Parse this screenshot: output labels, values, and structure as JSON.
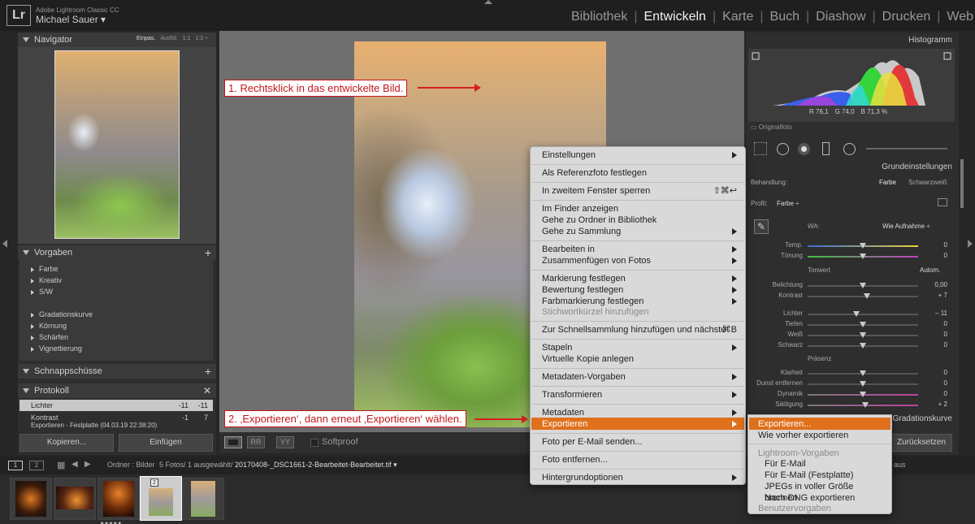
{
  "app": {
    "name": "Adobe Lightroom Classic CC",
    "user": "Michael Sauer ▾",
    "logo": "Lr"
  },
  "modules": [
    "Bibliothek",
    "Entwickeln",
    "Karte",
    "Buch",
    "Diashow",
    "Drucken",
    "Web"
  ],
  "active_module": "Entwickeln",
  "left": {
    "navigator": {
      "title": "Navigator",
      "zoom": [
        "Einpas.",
        "Ausfül.",
        "1:1",
        "1:2 ÷"
      ]
    },
    "presets": {
      "title": "Vorgaben",
      "items": [
        "Farbe",
        "Kreativ",
        "S/W",
        "Gradationskurve",
        "Körnung",
        "Schärfen",
        "Vignettierung"
      ]
    },
    "snapshots": {
      "title": "Schnappschüsse"
    },
    "history": {
      "title": "Protokoll",
      "rows": [
        {
          "name": "Lichter",
          "a": "-11",
          "b": "-11"
        },
        {
          "name": "Kontrast",
          "a": "-1",
          "b": "7"
        },
        {
          "name": "Exportieren - Festplatte (04.03.19 22:38:20)",
          "a": "",
          "b": ""
        }
      ]
    },
    "copy_label": "Kopieren...",
    "paste_label": "Einfügen"
  },
  "toolbar": {
    "softproof": "Softproof"
  },
  "annotations": {
    "step1": "1. Rechtsklick in das entwickelte Bild.",
    "step2": "2. ‚Exportieren‘, dann erneut ‚Exportieren‘ wählen."
  },
  "context_menu": {
    "items": [
      {
        "label": "Einstellungen",
        "sub": true
      },
      {
        "label": "Als Referenzfoto festlegen"
      },
      {
        "label": "In zweitem Fenster sperren",
        "shortcut": "⇧⌘↩"
      },
      {
        "label": "Im Finder anzeigen"
      },
      {
        "label": "Gehe zu Ordner in Bibliothek"
      },
      {
        "label": "Gehe zu Sammlung",
        "sub": true
      },
      {
        "label": "Bearbeiten in",
        "sub": true
      },
      {
        "label": "Zusammenfügen von Fotos",
        "sub": true
      },
      {
        "label": "Markierung festlegen",
        "sub": true
      },
      {
        "label": "Bewertung festlegen",
        "sub": true
      },
      {
        "label": "Farbmarkierung festlegen",
        "sub": true
      },
      {
        "label": "Stichwortkürzel hinzufügen",
        "disabled": true
      },
      {
        "label": "Zur Schnellsammlung hinzufügen und nächste",
        "shortcut": "⌘B"
      },
      {
        "label": "Stapeln",
        "sub": true
      },
      {
        "label": "Virtuelle Kopie anlegen"
      },
      {
        "label": "Metadaten-Vorgaben",
        "sub": true
      },
      {
        "label": "Transformieren",
        "sub": true
      },
      {
        "label": "Metadaten",
        "sub": true
      },
      {
        "label": "Exportieren",
        "sub": true,
        "highlighted": true
      },
      {
        "label": "Foto per E-Mail senden..."
      },
      {
        "label": "Foto entfernen..."
      },
      {
        "label": "Hintergrundoptionen",
        "sub": true
      }
    ]
  },
  "export_submenu": {
    "items": [
      {
        "label": "Exportieren...",
        "highlighted": true
      },
      {
        "label": "Wie vorher exportieren"
      },
      {
        "label": "Lightroom-Vorgaben",
        "disabled": true
      },
      {
        "label": "Für E-Mail"
      },
      {
        "label": "Für E-Mail (Festplatte)"
      },
      {
        "label": "JPEGs in voller Größe brennen"
      },
      {
        "label": "Nach DNG exportieren"
      },
      {
        "label": "Benutzervorgaben",
        "disabled": true
      }
    ]
  },
  "right": {
    "histogram": {
      "title": "Histogramm",
      "r": "R  76,1",
      "g": "G  74,0",
      "b": "B  71,3 %",
      "original": "Originalfoto"
    },
    "basic": {
      "title": "Grundeinstellungen",
      "treatment": "Behandlung:",
      "color": "Farbe",
      "bw": "Schwarzweiß",
      "profile": "Profil:",
      "profile_val": "Farbe ÷",
      "wb": "WA:",
      "wb_val": "Wie Aufnahme ÷",
      "tone": "Tonwert",
      "auto": "Autom.",
      "presence": "Präsenz",
      "sliders": [
        {
          "label": "Temp.",
          "value": "0",
          "pos": 0.5
        },
        {
          "label": "Tönung",
          "value": "0",
          "pos": 0.5
        },
        {
          "label": "Belichtung",
          "value": "0,00",
          "pos": 0.5
        },
        {
          "label": "Kontrast",
          "value": "+ 7",
          "pos": 0.54
        },
        {
          "label": "Lichter",
          "value": "– 11",
          "pos": 0.44
        },
        {
          "label": "Tiefen",
          "value": "0",
          "pos": 0.5
        },
        {
          "label": "Weiß",
          "value": "0",
          "pos": 0.5
        },
        {
          "label": "Schwarz",
          "value": "0",
          "pos": 0.5
        },
        {
          "label": "Klarheit",
          "value": "0",
          "pos": 0.5
        },
        {
          "label": "Dunst entfernen",
          "value": "0",
          "pos": 0.5
        },
        {
          "label": "Dynamik",
          "value": "0",
          "pos": 0.5
        },
        {
          "label": "Sättigung",
          "value": "+ 2",
          "pos": 0.52
        }
      ]
    },
    "curve_title": "Gradationskurve",
    "reset": "Zurücksetzen",
    "sync": "aus"
  },
  "filmstrip": {
    "path": "Ordner : Bilder",
    "count": "5 Fotos/ 1 ausgewählt/",
    "file": "20170408-_DSC1661-2-Bearbeitet-Bearbeitet.tif ▾",
    "page1": "1",
    "page2": "2",
    "selected_badge": "2",
    "stars": "★★★★★"
  },
  "colors": {
    "accent": "#e0701c",
    "annotation": "#c4161c"
  }
}
